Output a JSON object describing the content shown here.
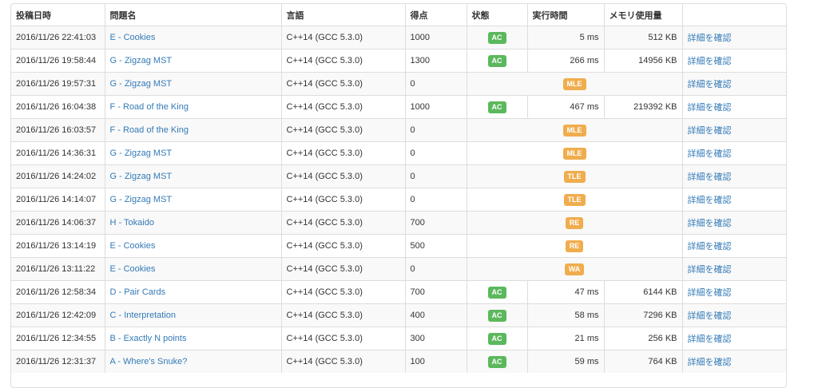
{
  "colors": {
    "ac": "#5cb85c",
    "warn": "#f0ad4e",
    "link": "#337ab7"
  },
  "headers": [
    "投稿日時",
    "問題名",
    "言語",
    "得点",
    "状態",
    "実行時間",
    "メモリ使用量",
    ""
  ],
  "rows": [
    {
      "date": "2016/11/26 22:41:03",
      "problem": "E - Cookies",
      "lang": "C++14 (GCC 5.3.0)",
      "score": "1000",
      "status": "AC",
      "time": "5 ms",
      "memory": "512 KB",
      "detail": "詳細を確認"
    },
    {
      "date": "2016/11/26 19:58:44",
      "problem": "G - Zigzag MST",
      "lang": "C++14 (GCC 5.3.0)",
      "score": "1300",
      "status": "AC",
      "time": "266 ms",
      "memory": "14956 KB",
      "detail": "詳細を確認"
    },
    {
      "date": "2016/11/26 19:57:31",
      "problem": "G - Zigzag MST",
      "lang": "C++14 (GCC 5.3.0)",
      "score": "0",
      "status": "MLE",
      "time": "",
      "memory": "",
      "detail": "詳細を確認"
    },
    {
      "date": "2016/11/26 16:04:38",
      "problem": "F - Road of the King",
      "lang": "C++14 (GCC 5.3.0)",
      "score": "1000",
      "status": "AC",
      "time": "467 ms",
      "memory": "219392 KB",
      "detail": "詳細を確認"
    },
    {
      "date": "2016/11/26 16:03:57",
      "problem": "F - Road of the King",
      "lang": "C++14 (GCC 5.3.0)",
      "score": "0",
      "status": "MLE",
      "time": "",
      "memory": "",
      "detail": "詳細を確認"
    },
    {
      "date": "2016/11/26 14:36:31",
      "problem": "G - Zigzag MST",
      "lang": "C++14 (GCC 5.3.0)",
      "score": "0",
      "status": "MLE",
      "time": "",
      "memory": "",
      "detail": "詳細を確認"
    },
    {
      "date": "2016/11/26 14:24:02",
      "problem": "G - Zigzag MST",
      "lang": "C++14 (GCC 5.3.0)",
      "score": "0",
      "status": "TLE",
      "time": "",
      "memory": "",
      "detail": "詳細を確認"
    },
    {
      "date": "2016/11/26 14:14:07",
      "problem": "G - Zigzag MST",
      "lang": "C++14 (GCC 5.3.0)",
      "score": "0",
      "status": "TLE",
      "time": "",
      "memory": "",
      "detail": "詳細を確認"
    },
    {
      "date": "2016/11/26 14:06:37",
      "problem": "H - Tokaido",
      "lang": "C++14 (GCC 5.3.0)",
      "score": "700",
      "status": "RE",
      "time": "",
      "memory": "",
      "detail": "詳細を確認"
    },
    {
      "date": "2016/11/26 13:14:19",
      "problem": "E - Cookies",
      "lang": "C++14 (GCC 5.3.0)",
      "score": "500",
      "status": "RE",
      "time": "",
      "memory": "",
      "detail": "詳細を確認"
    },
    {
      "date": "2016/11/26 13:11:22",
      "problem": "E - Cookies",
      "lang": "C++14 (GCC 5.3.0)",
      "score": "0",
      "status": "WA",
      "time": "",
      "memory": "",
      "detail": "詳細を確認"
    },
    {
      "date": "2016/11/26 12:58:34",
      "problem": "D - Pair Cards",
      "lang": "C++14 (GCC 5.3.0)",
      "score": "700",
      "status": "AC",
      "time": "47 ms",
      "memory": "6144 KB",
      "detail": "詳細を確認"
    },
    {
      "date": "2016/11/26 12:42:09",
      "problem": "C - Interpretation",
      "lang": "C++14 (GCC 5.3.0)",
      "score": "400",
      "status": "AC",
      "time": "58 ms",
      "memory": "7296 KB",
      "detail": "詳細を確認"
    },
    {
      "date": "2016/11/26 12:34:55",
      "problem": "B - Exactly N points",
      "lang": "C++14 (GCC 5.3.0)",
      "score": "300",
      "status": "AC",
      "time": "21 ms",
      "memory": "256 KB",
      "detail": "詳細を確認"
    },
    {
      "date": "2016/11/26 12:31:37",
      "problem": "A - Where's Snuke?",
      "lang": "C++14 (GCC 5.3.0)",
      "score": "100",
      "status": "AC",
      "time": "59 ms",
      "memory": "764 KB",
      "detail": "詳細を確認"
    }
  ]
}
